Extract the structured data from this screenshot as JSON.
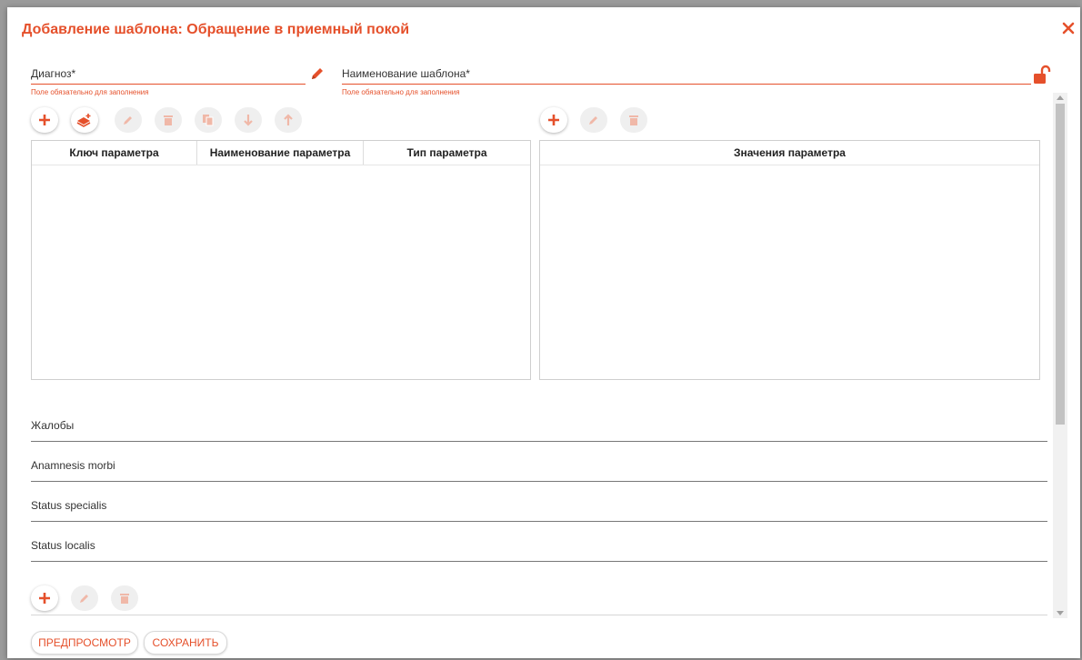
{
  "dialog": {
    "title": "Добавление шаблона: Обращение в приемный покой"
  },
  "diagnosis": {
    "label": "Диагноз*",
    "error": "Поле обязательно для заполнения"
  },
  "template_name": {
    "label": "Наименование шаблона*",
    "error": "Поле обязательно для заполнения"
  },
  "params_table": {
    "columns": [
      "Ключ параметра",
      "Наименование параметра",
      "Тип параметра"
    ]
  },
  "values_table": {
    "columns": [
      "Значения параметра"
    ]
  },
  "text_fields": [
    {
      "label": "Жалобы"
    },
    {
      "label": "Anamnesis morbi"
    },
    {
      "label": "Status specialis"
    },
    {
      "label": "Status localis"
    }
  ],
  "actions": {
    "preview": "ПРЕДПРОСМОТР",
    "save": "СОХРАНИТЬ"
  },
  "colors": {
    "accent": "#e5502b",
    "disabled_icon": "#f0b8a8"
  }
}
